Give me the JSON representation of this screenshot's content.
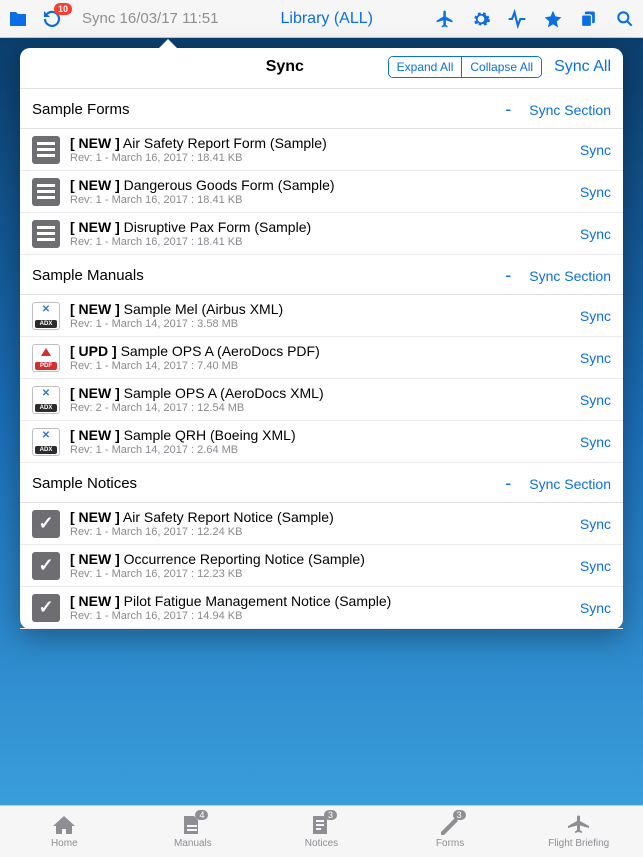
{
  "topbar": {
    "sync_time": "Sync 16/03/17 11:51",
    "title": "Library (ALL)",
    "refresh_badge": "10"
  },
  "popover": {
    "title": "Sync",
    "expand_all": "Expand All",
    "collapse_all": "Collapse All",
    "sync_all": "Sync All"
  },
  "section_labels": {
    "toggle": "-",
    "sync_section": "Sync Section",
    "sync_row": "Sync"
  },
  "sections": [
    {
      "title": "Sample Forms",
      "items": [
        {
          "icon": "doc",
          "tag": "[ NEW ]",
          "name": "Air Safety Report Form (Sample)",
          "meta": "Rev: 1 - March 16, 2017 : 18.41 KB"
        },
        {
          "icon": "doc",
          "tag": "[ NEW ]",
          "name": "Dangerous Goods Form (Sample)",
          "meta": "Rev: 1 - March 16, 2017 : 18.41 KB"
        },
        {
          "icon": "doc",
          "tag": "[ NEW ]",
          "name": "Disruptive Pax Form (Sample)",
          "meta": "Rev: 1 - March 16, 2017 : 18.41 KB"
        }
      ]
    },
    {
      "title": "Sample Manuals",
      "items": [
        {
          "icon": "xml",
          "tag": "[ NEW ]",
          "name": "Sample Mel (Airbus XML)",
          "meta": "Rev: 1 - March 14, 2017 : 3.58 MB"
        },
        {
          "icon": "pdf",
          "tag": "[ UPD ]",
          "name": "Sample OPS A (AeroDocs PDF)",
          "meta": "Rev: 1 - March 14, 2017 : 7.40 MB"
        },
        {
          "icon": "xml",
          "tag": "[ NEW ]",
          "name": "Sample OPS A (AeroDocs XML)",
          "meta": "Rev: 2 - March 14, 2017 : 12.54 MB"
        },
        {
          "icon": "xml",
          "tag": "[ NEW ]",
          "name": "Sample QRH (Boeing XML)",
          "meta": "Rev: 1 - March 14, 2017 : 2.64 MB"
        }
      ]
    },
    {
      "title": "Sample Notices",
      "items": [
        {
          "icon": "chk",
          "tag": "[ NEW ]",
          "name": "Air Safety Report Notice (Sample)",
          "meta": "Rev: 1 - March 16, 2017 : 12.24 KB"
        },
        {
          "icon": "chk",
          "tag": "[ NEW ]",
          "name": "Occurrence Reporting Notice (Sample)",
          "meta": "Rev: 1 - March 16, 2017 : 12.23 KB"
        },
        {
          "icon": "chk",
          "tag": "[ NEW ]",
          "name": "Pilot Fatigue Management Notice (Sample)",
          "meta": "Rev: 1 - March 16, 2017 : 14.94 KB"
        }
      ]
    }
  ],
  "tabs": [
    {
      "label": "Home",
      "badge": ""
    },
    {
      "label": "Manuals",
      "badge": "4"
    },
    {
      "label": "Notices",
      "badge": "3"
    },
    {
      "label": "Forms",
      "badge": "3"
    },
    {
      "label": "Flight Briefing",
      "badge": ""
    }
  ]
}
